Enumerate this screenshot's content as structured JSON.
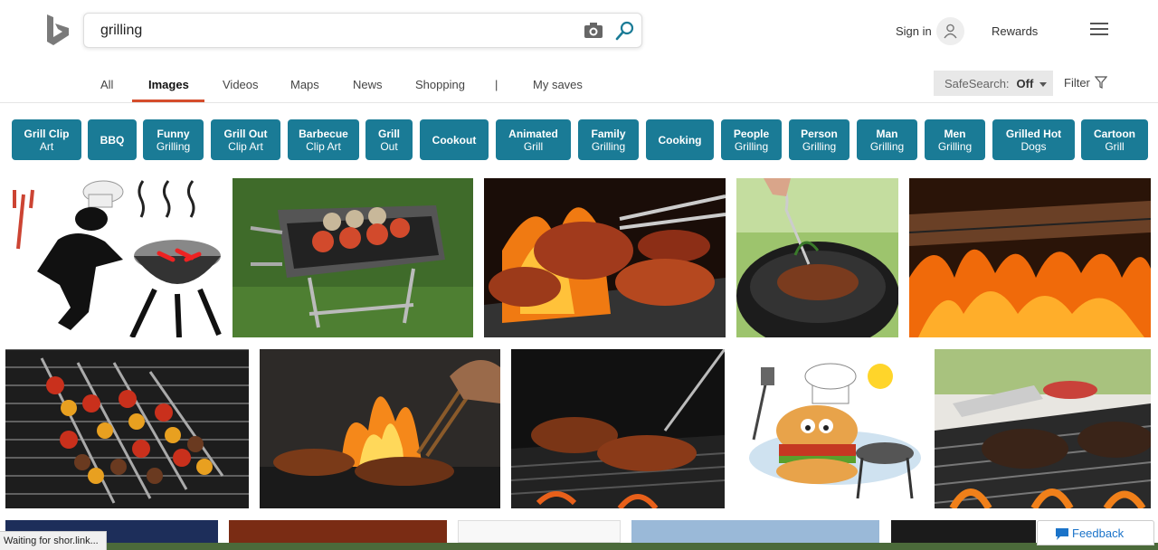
{
  "search": {
    "query": "grilling"
  },
  "header": {
    "signin": "Sign in",
    "rewards": "Rewards"
  },
  "tabs": [
    {
      "label": "All"
    },
    {
      "label": "Images"
    },
    {
      "label": "Videos"
    },
    {
      "label": "Maps"
    },
    {
      "label": "News"
    },
    {
      "label": "Shopping"
    },
    {
      "label": "|"
    },
    {
      "label": "My saves"
    }
  ],
  "safesearch": {
    "label": "SafeSearch:",
    "value": "Off"
  },
  "filter": {
    "label": "Filter"
  },
  "chips": [
    {
      "line1": "Grill Clip",
      "line2": "Art"
    },
    {
      "line1": "BBQ",
      "line2": ""
    },
    {
      "line1": "Funny",
      "line2": "Grilling"
    },
    {
      "line1": "Grill Out",
      "line2": "Clip Art"
    },
    {
      "line1": "Barbecue",
      "line2": "Clip Art"
    },
    {
      "line1": "Grill",
      "line2": "Out"
    },
    {
      "line1": "Cookout",
      "line2": ""
    },
    {
      "line1": "Animated",
      "line2": "Grill"
    },
    {
      "line1": "Family",
      "line2": "Grilling"
    },
    {
      "line1": "Cooking",
      "line2": ""
    },
    {
      "line1": "People",
      "line2": "Grilling"
    },
    {
      "line1": "Person",
      "line2": "Grilling"
    },
    {
      "line1": "Man",
      "line2": "Grilling"
    },
    {
      "line1": "Men",
      "line2": "Grilling"
    },
    {
      "line1": "Grilled Hot",
      "line2": "Dogs"
    },
    {
      "line1": "Cartoon",
      "line2": "Grill"
    }
  ],
  "status": {
    "text": "Waiting for shor.link..."
  },
  "feedback": {
    "label": "Feedback"
  },
  "colors": {
    "chip": "#1a7b96",
    "accent": "#d54d2c",
    "link": "#1a73c9"
  }
}
